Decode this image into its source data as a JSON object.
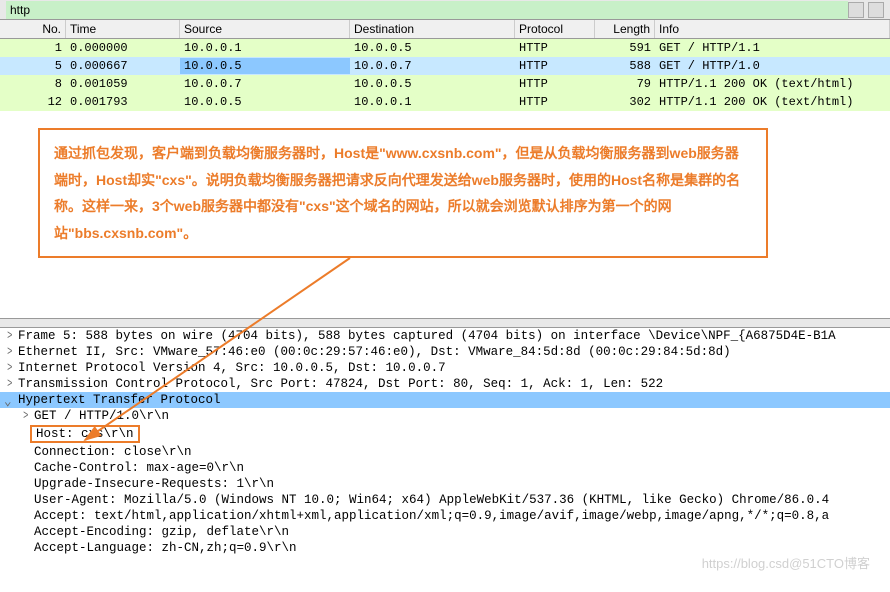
{
  "filter": {
    "value": "http"
  },
  "columns": {
    "no": "No.",
    "time": "Time",
    "source": "Source",
    "dest": "Destination",
    "proto": "Protocol",
    "len": "Length",
    "info": "Info"
  },
  "packets": [
    {
      "no": "1",
      "time": "0.000000",
      "src": "10.0.0.1",
      "dst": "10.0.0.5",
      "proto": "HTTP",
      "len": "591",
      "info": "GET / HTTP/1.1",
      "cls": "http-get"
    },
    {
      "no": "5",
      "time": "0.000667",
      "src": "10.0.0.5",
      "dst": "10.0.0.7",
      "proto": "HTTP",
      "len": "588",
      "info": "GET / HTTP/1.0",
      "cls": "http-get selected"
    },
    {
      "no": "8",
      "time": "0.001059",
      "src": "10.0.0.7",
      "dst": "10.0.0.5",
      "proto": "HTTP",
      "len": "79",
      "info": "HTTP/1.1 200 OK  (text/html)",
      "cls": "http-ok"
    },
    {
      "no": "12",
      "time": "0.001793",
      "src": "10.0.0.5",
      "dst": "10.0.0.1",
      "proto": "HTTP",
      "len": "302",
      "info": "HTTP/1.1 200 OK  (text/html)",
      "cls": "http-ok"
    }
  ],
  "annotation": "通过抓包发现，客户端到负载均衡服务器时，Host是\"www.cxsnb.com\"，但是从负载均衡服务器到web服务器端时，Host却实\"cxs\"。说明负载均衡服务器把请求反向代理发送给web服务器时，使用的Host名称是集群的名称。这样一来，3个web服务器中都没有\"cxs\"这个域名的网站，所以就会浏览默认排序为第一个的网站\"bbs.cxsnb.com\"。",
  "detail": {
    "frame": "Frame 5: 588 bytes on wire (4704 bits), 588 bytes captured (4704 bits) on interface \\Device\\NPF_{A6875D4E-B1A",
    "eth": "Ethernet II, Src: VMware_57:46:e0 (00:0c:29:57:46:e0), Dst: VMware_84:5d:8d (00:0c:29:84:5d:8d)",
    "ip": "Internet Protocol Version 4, Src: 10.0.0.5, Dst: 10.0.0.7",
    "tcp": "Transmission Control Protocol, Src Port: 47824, Dst Port: 80, Seq: 1, Ack: 1, Len: 522",
    "http_header": "Hypertext Transfer Protocol",
    "get": "GET / HTTP/1.0\\r\\n",
    "host": "Host: cxs\\r\\n",
    "conn": "Connection: close\\r\\n",
    "cache": "Cache-Control: max-age=0\\r\\n",
    "upgrade": "Upgrade-Insecure-Requests: 1\\r\\n",
    "ua": "User-Agent: Mozilla/5.0 (Windows NT 10.0; Win64; x64) AppleWebKit/537.36 (KHTML, like Gecko) Chrome/86.0.4",
    "accept": "Accept: text/html,application/xhtml+xml,application/xml;q=0.9,image/avif,image/webp,image/apng,*/*;q=0.8,a",
    "accenc": "Accept-Encoding: gzip, deflate\\r\\n",
    "acclang": "Accept-Language: zh-CN,zh;q=0.9\\r\\n"
  },
  "watermark": "https://blog.csd@51CTO博客"
}
